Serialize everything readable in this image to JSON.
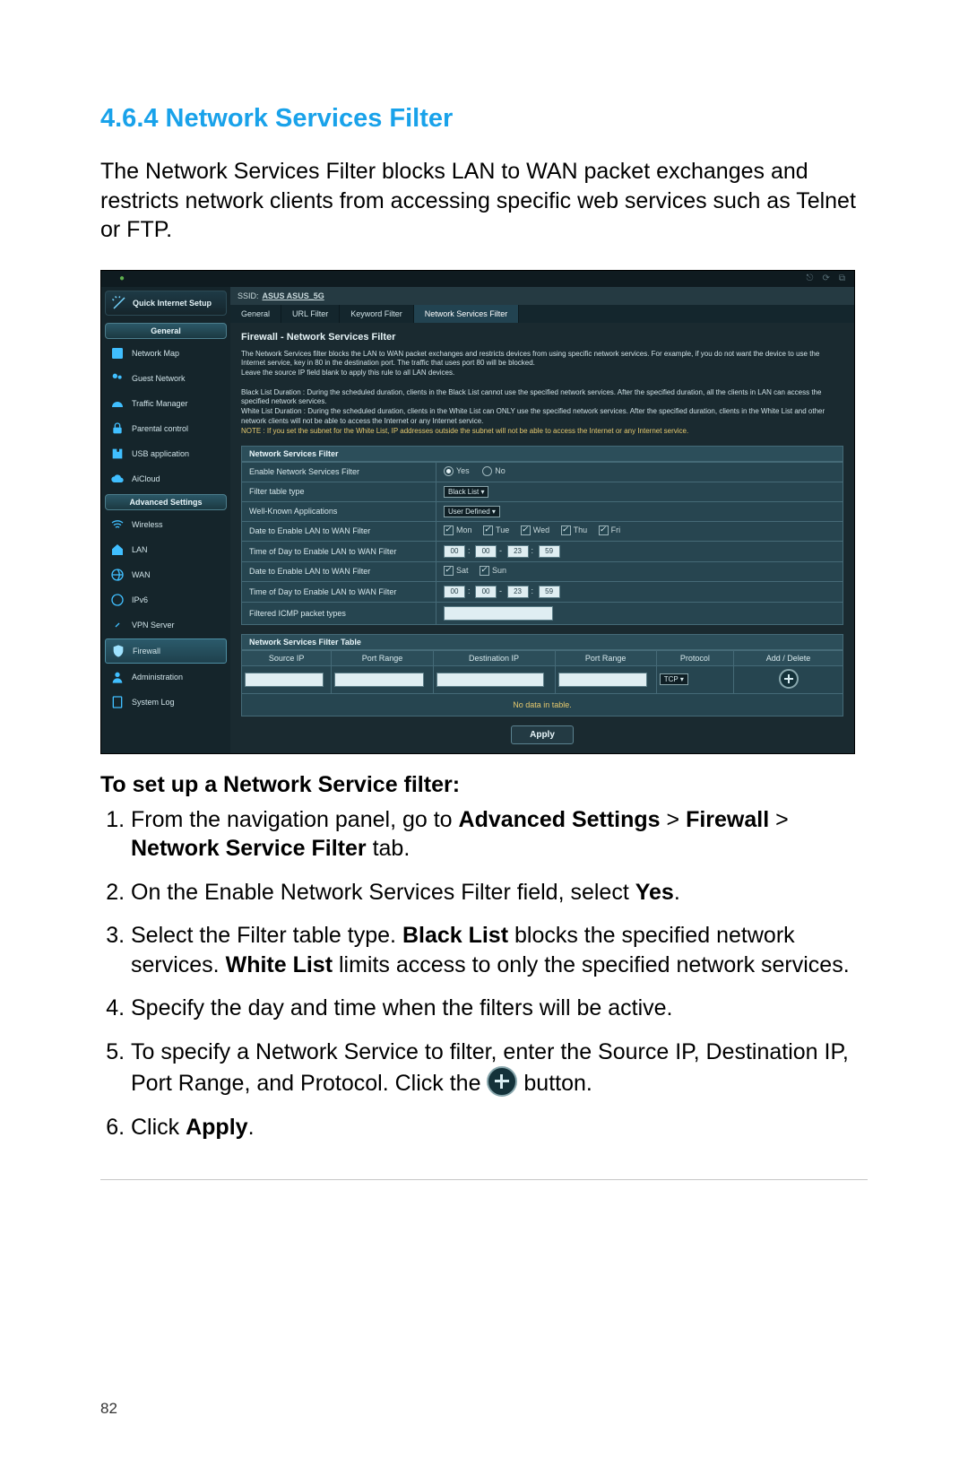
{
  "page_number": "82",
  "heading": "4.6.4 Network Services Filter",
  "intro": "The Network Services Filter blocks LAN to WAN packet exchanges and restricts network clients from accessing specific web services such as Telnet or FTP.",
  "subhead": "To set up a Network Service filter:",
  "steps": {
    "s1a": "From the navigation panel, go to ",
    "s1b_bold": "Advanced Settings",
    "s1c": " > ",
    "s1d_bold": "Firewall",
    "s1e": " > ",
    "s1f_bold": "Network Service Filter",
    "s1g": " tab.",
    "s2a": "On the Enable Network Services Filter field, select ",
    "s2b_bold": "Yes",
    "s2c": ".",
    "s3a": "Select the Filter table type. ",
    "s3b_bold": "Black List",
    "s3c": " blocks the specified network services. ",
    "s3d_bold": "White List",
    "s3e": " limits access to only the specified network services.",
    "s4": "Specify the day and time when the filters will be active.",
    "s5a": "To specify a Network Service to filter, enter the Source IP, Destination IP, Port Range, and Protocol. Click the ",
    "s5b": " button.",
    "s6a": "Click ",
    "s6b_bold": "Apply",
    "s6c": "."
  },
  "ui": {
    "qis": "Quick Internet Setup",
    "groups": {
      "general": "General",
      "advanced": "Advanced Settings"
    },
    "nav_general": [
      "Network Map",
      "Guest Network",
      "Traffic Manager",
      "Parental control",
      "USB application",
      "AiCloud"
    ],
    "nav_advanced": [
      "Wireless",
      "LAN",
      "WAN",
      "IPv6",
      "VPN Server",
      "Firewall",
      "Administration",
      "System Log"
    ],
    "ssid_label": "SSID:",
    "ssid_value": "ASUS  ASUS_5G",
    "tabs": [
      "General",
      "URL Filter",
      "Keyword Filter",
      "Network Services Filter"
    ],
    "panel_title": "Firewall - Network Services Filter",
    "desc1": "The Network Services filter blocks the LAN to WAN packet exchanges and restricts devices from using specific network services. For example, if you do not want the device to use the Internet service, key in 80 in the destination port. The traffic that uses port 80 will be blocked.",
    "desc2": "Leave the source IP field blank to apply this rule to all LAN devices.",
    "desc3": "Black List Duration : During the scheduled duration, clients in the Black List cannot use the specified network services. After the specified duration, all the clients in LAN can access the specified network services.",
    "desc4": "White List Duration : During the scheduled duration, clients in the White List can ONLY use the specified network services. After the specified duration, clients in the White List and other network clients will not be able to access the Internet or any Internet service.",
    "desc5": "NOTE : If you set the subnet for the White List, IP addresses outside the subnet will not be able to access the Internet or any Internet service.",
    "sect_filter": "Network Services Filter",
    "rows": {
      "enable": "Enable Network Services Filter",
      "yes": "Yes",
      "no": "No",
      "ftt": "Filter table type",
      "ftt_val": "Black List",
      "wka": "Well-Known Applications",
      "wka_val": "User Defined",
      "d1": "Date to Enable LAN to WAN Filter",
      "days1": [
        "Mon",
        "Tue",
        "Wed",
        "Thu",
        "Fri"
      ],
      "t1": "Time of Day to Enable LAN to WAN Filter",
      "time1": [
        "00",
        "00",
        "23",
        "59"
      ],
      "d2": "Date to Enable LAN to WAN Filter",
      "days2": [
        "Sat",
        "Sun"
      ],
      "t2": "Time of Day to Enable LAN to WAN Filter",
      "time2": [
        "00",
        "00",
        "23",
        "59"
      ],
      "icmp": "Filtered ICMP packet types"
    },
    "sect_table": "Network Services Filter Table",
    "cols": [
      "Source IP",
      "Port Range",
      "Destination IP",
      "Port Range",
      "Protocol",
      "Add / Delete"
    ],
    "proto_val": "TCP",
    "no_data": "No data in table.",
    "apply": "Apply"
  }
}
